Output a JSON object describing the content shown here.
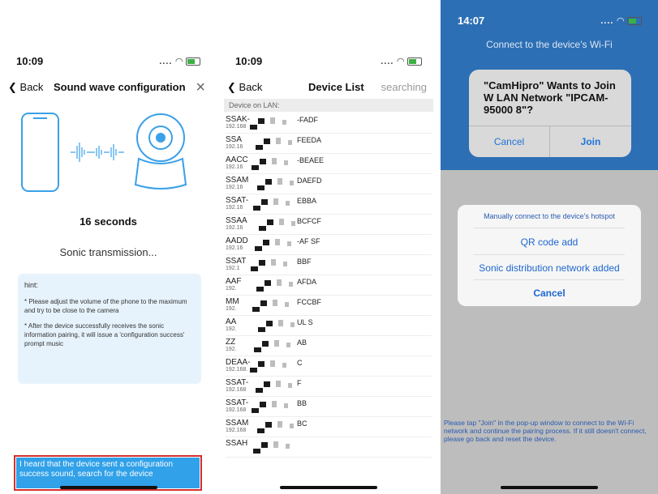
{
  "screen1": {
    "status": {
      "time": "10:09",
      "signal": "....",
      "wifi_icon": "wifi-icon"
    },
    "nav": {
      "back": "Back",
      "title": "Sound wave configuration",
      "close": "×"
    },
    "timer": "16 seconds",
    "status_text": "Sonic transmission...",
    "hint": {
      "title": "hint:",
      "items": [
        "* Please adjust the volume of the phone to the maximum and try to be close to the camera",
        "* After the device successfully receives the sonic information pairing, it will issue a 'configuration success' prompt music"
      ]
    },
    "action_button": "I heard that the device sent a configuration success sound, search for the device"
  },
  "screen2": {
    "status": {
      "time": "10:09",
      "signal": "...."
    },
    "nav": {
      "back": "Back",
      "title": "Device List",
      "status": "searching"
    },
    "section": "Device on LAN:",
    "devices": [
      {
        "name": "SSAK-",
        "ip": "192.168",
        "suffix": "-FADF"
      },
      {
        "name": "SSA",
        "ip": "192.16",
        "suffix": "FEEDA"
      },
      {
        "name": "AACC",
        "ip": "192.16",
        "suffix": "-BEAEE"
      },
      {
        "name": "SSAM",
        "ip": "192.16",
        "suffix": "DAEFD"
      },
      {
        "name": "SSAT-",
        "ip": "192.16",
        "suffix": "EBBA"
      },
      {
        "name": "SSAA",
        "ip": "192.16",
        "suffix": "BCFCF"
      },
      {
        "name": "AADD",
        "ip": "192.16",
        "suffix": "-AF SF"
      },
      {
        "name": "SSAT",
        "ip": "192.1",
        "suffix": "BBF"
      },
      {
        "name": "AAF",
        "ip": "192.",
        "suffix": "AFDA"
      },
      {
        "name": "MM",
        "ip": "192.",
        "suffix": "FCCBF"
      },
      {
        "name": "AA",
        "ip": "192.",
        "suffix": "UL S"
      },
      {
        "name": "ZZ",
        "ip": "192.",
        "suffix": "AB"
      },
      {
        "name": "DEAA-",
        "ip": "192.168.",
        "suffix": "C"
      },
      {
        "name": "SSAT-",
        "ip": "192.168",
        "suffix": "F"
      },
      {
        "name": "SSAT-",
        "ip": "192.168",
        "suffix": "BB"
      },
      {
        "name": "SSAM",
        "ip": "192.168",
        "suffix": "BC"
      },
      {
        "name": "SSAH",
        "ip": "",
        "suffix": ""
      }
    ]
  },
  "screen3": {
    "status": {
      "time": "14:07",
      "signal": "...."
    },
    "header": "Connect to the device's Wi-Fi",
    "alert": {
      "message": "\"CamHipro\" Wants to Join W LAN Network \"IPCAM-95000 8\"?",
      "cancel": "Cancel",
      "join": "Join"
    },
    "sheet": {
      "title": "Manually connect to the device's hotspot",
      "options": [
        "QR code add",
        "Sonic distribution network added",
        "Cancel"
      ]
    },
    "footer": "Please tap \"Join\" in the pop-up window to connect to the Wi-Fi network and continue the pairing process. If it still doesn't connect, please go back and reset the device."
  },
  "colors": {
    "accent": "#31a1e9",
    "alert_blue": "#2d6fb4",
    "highlight": "#d3302f",
    "hint_bg": "#e7f3fc"
  }
}
